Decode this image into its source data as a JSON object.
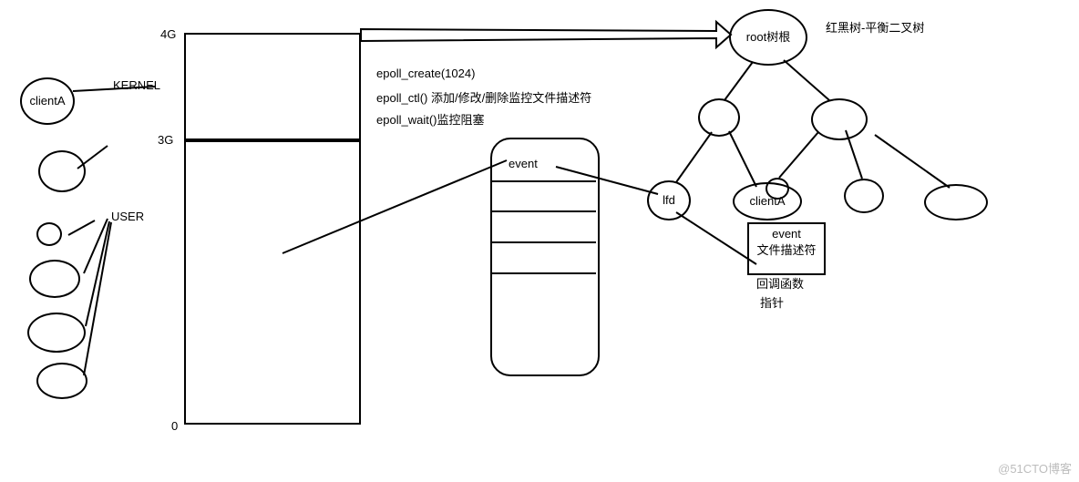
{
  "clients": {
    "clientA": "clientA"
  },
  "memory": {
    "mark4G": "4G",
    "kernel": "KERNEL",
    "mark3G": "3G",
    "user": "USER",
    "mark0": "0"
  },
  "api": {
    "create": "epoll_create(1024)",
    "ctl": "epoll_ctl()  添加/修改/删除监控文件描述符",
    "wait": "epoll_wait()监控阻塞"
  },
  "queue": {
    "event": "event"
  },
  "tree": {
    "title": "红黑树-平衡二叉树",
    "root": "root树根",
    "lfd": "lfd",
    "clientA": "clientA",
    "eventBox": {
      "event": "event",
      "fd": "文件描述符",
      "cb": "回调函数",
      "ptr": "指针"
    }
  },
  "watermark": "@51CTO博客"
}
